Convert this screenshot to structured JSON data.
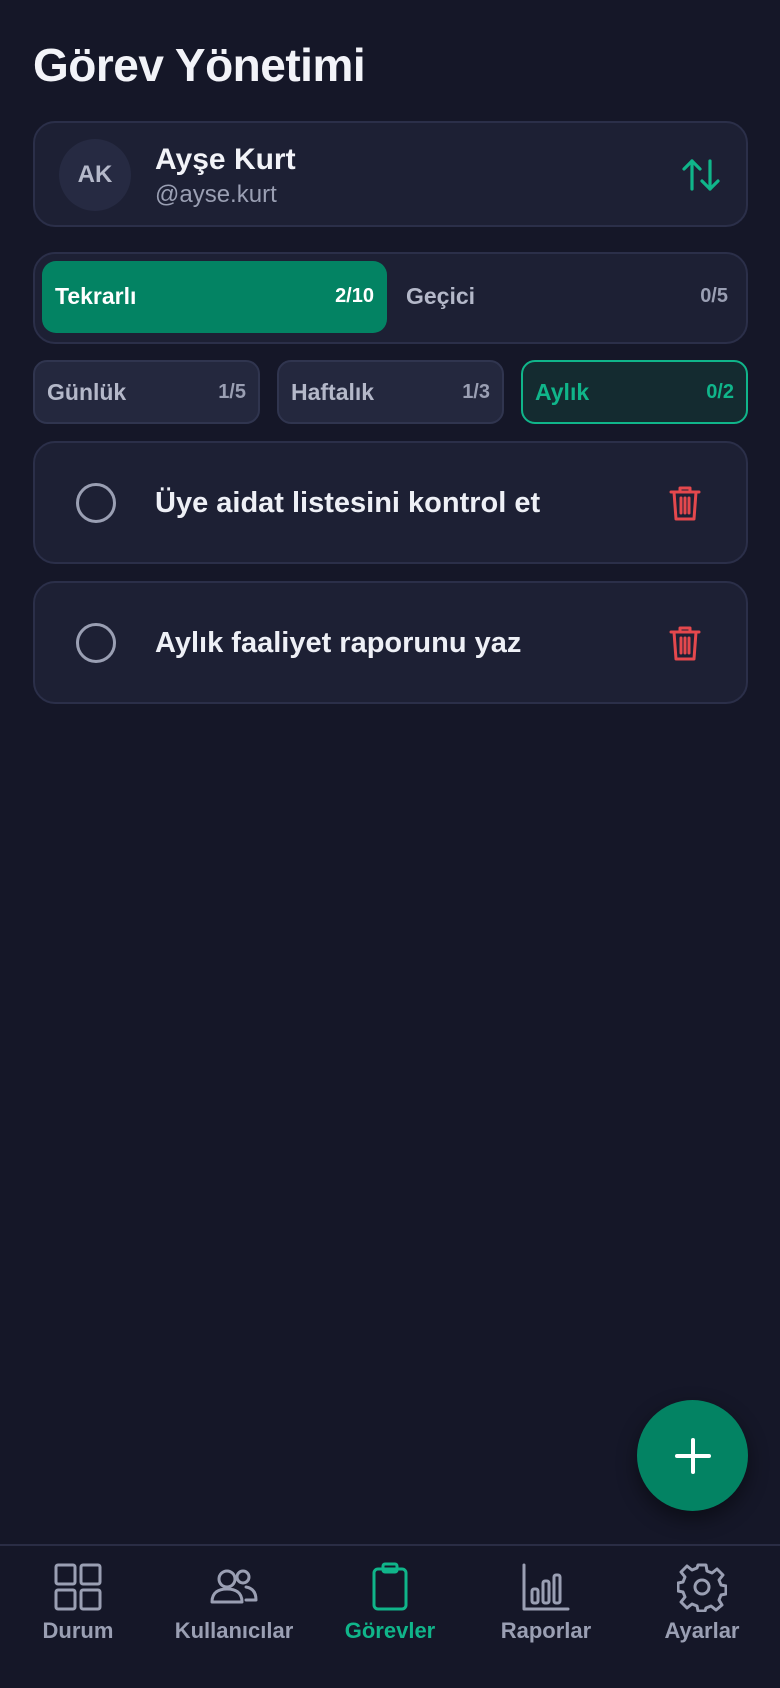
{
  "page": {
    "title": "Görev Yönetimi"
  },
  "user": {
    "initials": "AK",
    "name": "Ayşe Kurt",
    "handle": "@ayse.kurt",
    "swap_icon": "arrows-up-down-icon"
  },
  "task_types": [
    {
      "label": "Tekrarlı",
      "count": "2/10",
      "active": true
    },
    {
      "label": "Geçici",
      "count": "0/5",
      "active": false
    }
  ],
  "periods": [
    {
      "label": "Günlük",
      "count": "1/5",
      "active": false
    },
    {
      "label": "Haftalık",
      "count": "1/3",
      "active": false
    },
    {
      "label": "Aylık",
      "count": "0/2",
      "active": true
    }
  ],
  "tasks": [
    {
      "text": "Üye aidat listesini kontrol et",
      "done": false
    },
    {
      "text": "Aylık faaliyet raporunu yaz",
      "done": false
    }
  ],
  "fab": {
    "icon": "plus-icon"
  },
  "nav": [
    {
      "label": "Durum",
      "icon": "grid-icon",
      "active": false
    },
    {
      "label": "Kullanıcılar",
      "icon": "users-icon",
      "active": false
    },
    {
      "label": "Görevler",
      "icon": "clipboard-icon",
      "active": true
    },
    {
      "label": "Raporlar",
      "icon": "bar-chart-icon",
      "active": false
    },
    {
      "label": "Ayarlar",
      "icon": "gear-icon",
      "active": false
    }
  ],
  "colors": {
    "background": "#151728",
    "card": "#1d2034",
    "accent": "#038363",
    "accent_text": "#10b58a",
    "danger": "#e5484d",
    "muted": "#9a9fb3"
  }
}
